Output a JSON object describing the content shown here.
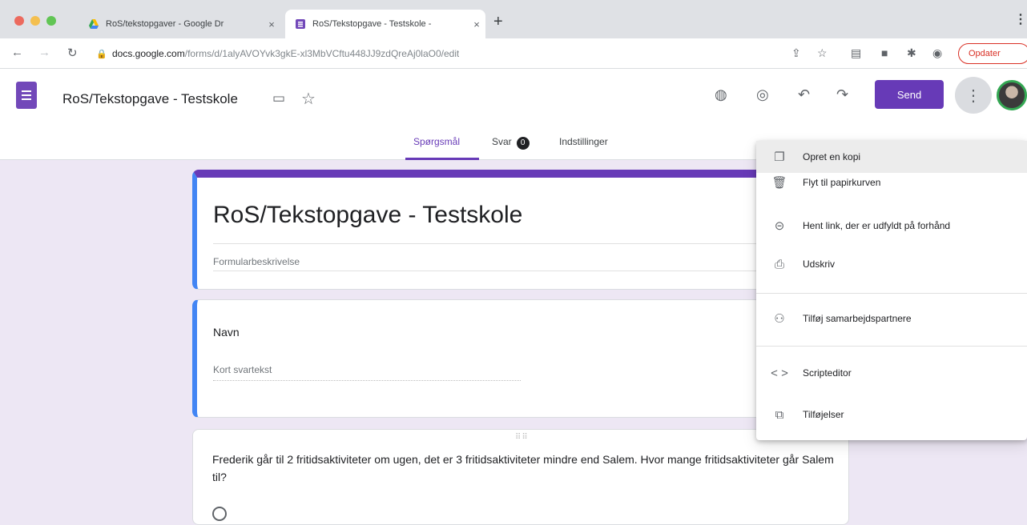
{
  "browser": {
    "tabs": [
      {
        "title": "RoS/tekstopgaver - Google Dr",
        "close": "×",
        "icon": "google-drive-icon"
      },
      {
        "title": "RoS/Tekstopgave - Testskole -",
        "close": "×",
        "icon": "google-forms-icon"
      }
    ],
    "new_tab": "+",
    "address": {
      "host": "docs.google.com",
      "path": "/forms/d/1alyAVOYvk3gkE-xl3MbVCftu448JJ9zdQreAj0laO0/edit"
    },
    "update_button": "Opdater",
    "menu_dots": "⋮"
  },
  "header": {
    "doc_title": "RoS/Tekstopgave - Testskole",
    "send_label": "Send",
    "tabs": {
      "questions": "Spørgsmål",
      "responses": "Svar",
      "responses_count": "0",
      "settings": "Indstillinger"
    }
  },
  "form": {
    "title": "RoS/Tekstopgave - Testskole",
    "description_placeholder": "Formularbeskrivelse",
    "questions": [
      {
        "title": "Navn",
        "answer_placeholder": "Kort svartekst"
      },
      {
        "title": "Frederik går til 2 fritidsaktiviteter om ugen, det er 3 fritidsaktiviteter mindre end Salem. Hvor mange fritidsaktiviteter går Salem til?"
      }
    ]
  },
  "menu": {
    "items": [
      {
        "label": "Opret en kopi",
        "icon": "copy-icon"
      },
      {
        "label": "Flyt til papirkurven",
        "icon": "trash-icon"
      },
      {
        "label": "Hent link, der er udfyldt på forhånd",
        "icon": "link-icon"
      },
      {
        "label": "Udskriv",
        "icon": "print-icon"
      },
      {
        "label": "Tilføj samarbejdspartnere",
        "icon": "add-people-icon"
      },
      {
        "label": "Scripteditor",
        "icon": "code-icon"
      },
      {
        "label": "Tilføjelser",
        "icon": "puzzle-icon"
      }
    ]
  },
  "colors": {
    "accent": "#673ab7",
    "active_border": "#4285f4",
    "background": "#ede7f4"
  }
}
